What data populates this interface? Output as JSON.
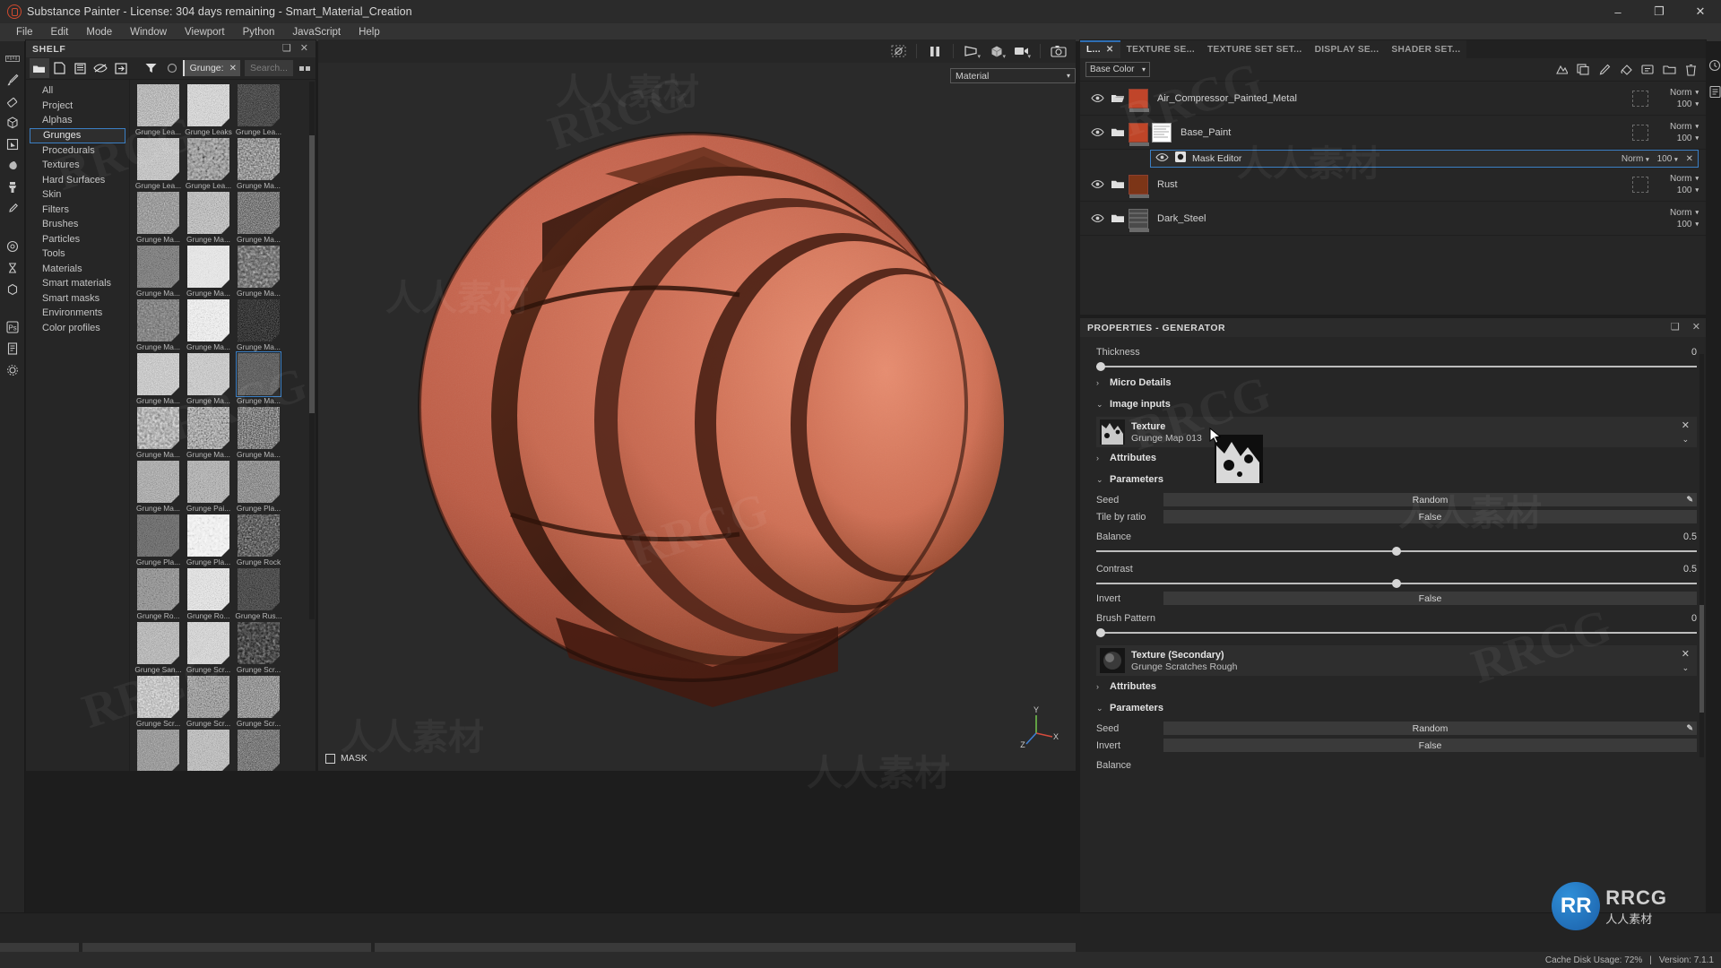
{
  "window": {
    "title": "Substance Painter - License: 304 days remaining - Smart_Material_Creation",
    "app_icon": "substance-logo-icon",
    "minimize": "–",
    "maximize": "❐",
    "close": "✕"
  },
  "menu": {
    "items": [
      "File",
      "Edit",
      "Mode",
      "Window",
      "Viewport",
      "Python",
      "JavaScript",
      "Help"
    ]
  },
  "toolstrip": {
    "tools": [
      {
        "name": "paint-tool",
        "icon": "brush-icon"
      },
      {
        "name": "eraser-tool",
        "icon": "eraser-icon"
      },
      {
        "name": "projection-tool",
        "icon": "cube-icon"
      },
      {
        "name": "polygon-fill-tool",
        "icon": "polygon-fill-icon"
      },
      {
        "name": "smudge-tool",
        "icon": "smudge-icon"
      },
      {
        "name": "clone-tool",
        "icon": "clone-stamp-icon"
      },
      {
        "name": "color-picker-tool",
        "icon": "eyedropper-icon"
      },
      {
        "name": "material-tool",
        "icon": "sphere-icon"
      },
      {
        "name": "bake-tool",
        "icon": "hourglass-icon"
      },
      {
        "name": "geometry-tool",
        "icon": "geometry-icon"
      },
      {
        "name": "photoshop-link",
        "icon": "ps-icon"
      },
      {
        "name": "export-tool",
        "icon": "page-icon"
      },
      {
        "name": "settings-tool",
        "icon": "gear-icon"
      }
    ]
  },
  "shelf": {
    "title": "SHELF",
    "header_buttons": [
      "float-panel-icon",
      "close-icon"
    ],
    "toolbar_icons": [
      "folder-icon",
      "new-file-icon",
      "save-icon",
      "hide-icon",
      "import-icon",
      "filter-icon",
      "circle-icon"
    ],
    "filter_chip": {
      "label": "Grunge:",
      "close": "✕"
    },
    "search_placeholder": "Search...",
    "categories": [
      {
        "label": "All",
        "selected": false
      },
      {
        "label": "Project",
        "selected": false
      },
      {
        "label": "Alphas",
        "selected": false
      },
      {
        "label": "Grunges",
        "selected": true
      },
      {
        "label": "Procedurals",
        "selected": false
      },
      {
        "label": "Textures",
        "selected": false
      },
      {
        "label": "Hard Surfaces",
        "selected": false
      },
      {
        "label": "Skin",
        "selected": false
      },
      {
        "label": "Filters",
        "selected": false
      },
      {
        "label": "Brushes",
        "selected": false
      },
      {
        "label": "Particles",
        "selected": false
      },
      {
        "label": "Tools",
        "selected": false
      },
      {
        "label": "Materials",
        "selected": false
      },
      {
        "label": "Smart materials",
        "selected": false
      },
      {
        "label": "Smart masks",
        "selected": false
      },
      {
        "label": "Environments",
        "selected": false
      },
      {
        "label": "Color profiles",
        "selected": false
      }
    ],
    "assets": [
      {
        "label": "Grunge Lea...",
        "tone": "t-a",
        "selected": false
      },
      {
        "label": "Grunge Leaks",
        "tone": "t-b",
        "selected": false
      },
      {
        "label": "Grunge Lea...",
        "tone": "t-c",
        "selected": false
      },
      {
        "label": "Grunge Lea...",
        "tone": "t-d",
        "selected": false
      },
      {
        "label": "Grunge Lea...",
        "tone": "t-e",
        "selected": false
      },
      {
        "label": "Grunge Ma...",
        "tone": "t-f",
        "selected": false
      },
      {
        "label": "Grunge Ma...",
        "tone": "t-g",
        "selected": false
      },
      {
        "label": "Grunge Ma...",
        "tone": "t-h",
        "selected": false
      },
      {
        "label": "Grunge Ma...",
        "tone": "t-i",
        "selected": false
      },
      {
        "label": "Grunge Ma...",
        "tone": "t-j",
        "selected": false
      },
      {
        "label": "Grunge Ma...",
        "tone": "t-k",
        "selected": false
      },
      {
        "label": "Grunge Ma...",
        "tone": "t-l",
        "selected": false
      },
      {
        "label": "Grunge Ma...",
        "tone": "t-m",
        "selected": false
      },
      {
        "label": "Grunge Ma...",
        "tone": "t-n",
        "selected": false
      },
      {
        "label": "Grunge Ma...",
        "tone": "t-o",
        "selected": false
      },
      {
        "label": "Grunge Ma...",
        "tone": "t-p",
        "selected": false
      },
      {
        "label": "Grunge Ma...",
        "tone": "t-q",
        "selected": false
      },
      {
        "label": "Grunge Ma...",
        "tone": "t-r",
        "selected": true
      },
      {
        "label": "Grunge Ma...",
        "tone": "t-s",
        "selected": false
      },
      {
        "label": "Grunge Ma...",
        "tone": "t-t",
        "selected": false
      },
      {
        "label": "Grunge Ma...",
        "tone": "t-u",
        "selected": false
      },
      {
        "label": "Grunge Ma...",
        "tone": "t-v",
        "selected": false
      },
      {
        "label": "Grunge Pai...",
        "tone": "t-w",
        "selected": false
      },
      {
        "label": "Grunge Pla...",
        "tone": "t-x",
        "selected": false
      },
      {
        "label": "Grunge Pla...",
        "tone": "t-y",
        "selected": false
      },
      {
        "label": "Grunge Pla...",
        "tone": "t-z",
        "selected": false
      },
      {
        "label": "Grunge Rock",
        "tone": "t-a2",
        "selected": false
      },
      {
        "label": "Grunge Ro...",
        "tone": "t-b2",
        "selected": false
      },
      {
        "label": "Grunge Ro...",
        "tone": "t-c2",
        "selected": false
      },
      {
        "label": "Grunge Rus...",
        "tone": "t-d2",
        "selected": false
      },
      {
        "label": "Grunge San...",
        "tone": "t-e2",
        "selected": false
      },
      {
        "label": "Grunge Scr...",
        "tone": "t-f2",
        "selected": false
      },
      {
        "label": "Grunge Scr...",
        "tone": "t-g2",
        "selected": false
      },
      {
        "label": "Grunge Scr...",
        "tone": "t-h2",
        "selected": false
      },
      {
        "label": "Grunge Scr...",
        "tone": "t-i2",
        "selected": false
      },
      {
        "label": "Grunge Scr...",
        "tone": "t-j2",
        "selected": false
      },
      {
        "label": "",
        "tone": "t-k2",
        "selected": false
      },
      {
        "label": "",
        "tone": "t-l2",
        "selected": false
      },
      {
        "label": "",
        "tone": "t-m2",
        "selected": false
      }
    ]
  },
  "viewport": {
    "toolbar_icons": [
      "no-shader-icon",
      "pause-icon",
      "camera-frustum-icon",
      "3d-view-icon",
      "video-icon",
      "screenshot-icon"
    ],
    "material_select": {
      "value": "Material",
      "chev": "⌄"
    },
    "mask_badge": "MASK",
    "axis_labels": {
      "x": "X",
      "y": "Y",
      "z": "Z"
    }
  },
  "layers": {
    "tabs": [
      {
        "label": "L...",
        "active": true,
        "closable": true
      },
      {
        "label": "TEXTURE SE...",
        "active": false,
        "closable": false
      },
      {
        "label": "TEXTURE SET SET...",
        "active": false,
        "closable": false
      },
      {
        "label": "DISPLAY SE...",
        "active": false,
        "closable": false
      },
      {
        "label": "SHADER SET...",
        "active": false,
        "closable": false
      }
    ],
    "channel": {
      "value": "Base Color",
      "chev": "⌄"
    },
    "toolbar_icons": [
      "add-effect-icon",
      "copy-icon",
      "paint-layer-icon",
      "fill-layer-icon",
      "group-icon",
      "folder-icon",
      "delete-icon"
    ],
    "side_icons": [
      "history-icon",
      "list-icon"
    ],
    "rows": [
      {
        "name": "Air_Compressor_Painted_Metal",
        "type": "group-open",
        "blend": "Norm",
        "opacity": "100",
        "visible": true,
        "color": "#c0452a",
        "has_mask_slot": true,
        "has_mask_thumb": false
      },
      {
        "name": "Base_Paint",
        "type": "group-closed",
        "blend": "Norm",
        "opacity": "100",
        "visible": true,
        "color": "#bf4528",
        "has_mask_slot": true,
        "has_mask_thumb": true,
        "sublayer": {
          "name": "Mask Editor",
          "blend": "Norm",
          "opacity": "100",
          "visible": true,
          "selected": true,
          "close": "✕"
        }
      },
      {
        "name": "Rust",
        "type": "group-closed",
        "blend": "Norm",
        "opacity": "100",
        "visible": true,
        "color": "#7c3517",
        "has_mask_slot": true,
        "has_mask_thumb": false
      },
      {
        "name": "Dark_Steel",
        "type": "group-closed",
        "blend": "Norm",
        "opacity": "100",
        "visible": true,
        "color": "#4a4a4a",
        "has_mask_slot": false,
        "has_mask_thumb": false
      }
    ]
  },
  "properties": {
    "title": "PROPERTIES - GENERATOR",
    "header_buttons": [
      "float-panel-icon",
      "close-icon"
    ],
    "thickness": {
      "label": "Thickness",
      "value": "0",
      "knob_pct": 0
    },
    "micro_details": {
      "label": "Micro Details",
      "caret": "›",
      "expanded": false
    },
    "image_inputs": {
      "label": "Image inputs",
      "caret": "⌄",
      "expanded": true,
      "texture": {
        "title": "Texture",
        "subtitle": "Grunge Map 013",
        "close": "✕",
        "chev": "⌄"
      }
    },
    "attributes_1": {
      "label": "Attributes",
      "caret": "›",
      "expanded": false
    },
    "parameters_1": {
      "label": "Parameters",
      "caret": "⌄",
      "fields": [
        {
          "label": "Seed",
          "value": "Random",
          "kind": "text",
          "editable": true
        },
        {
          "label": "Tile by ratio",
          "value": "False",
          "kind": "text",
          "editable": false
        },
        {
          "label": "Balance",
          "value": "0.5",
          "kind": "slider",
          "knob_pct": 50
        },
        {
          "label": "Contrast",
          "value": "0.5",
          "kind": "slider",
          "knob_pct": 50
        },
        {
          "label": "Invert",
          "value": "False",
          "kind": "text",
          "editable": false
        },
        {
          "label": "Brush Pattern",
          "value": "0",
          "kind": "slider",
          "knob_pct": 0
        }
      ]
    },
    "texture_secondary": {
      "title": "Texture (Secondary)",
      "subtitle": "Grunge Scratches Rough",
      "close": "✕",
      "chev": "⌄"
    },
    "attributes_2": {
      "label": "Attributes",
      "caret": "›",
      "expanded": false
    },
    "parameters_2": {
      "label": "Parameters",
      "caret": "⌄",
      "fields": [
        {
          "label": "Seed",
          "value": "Random",
          "kind": "text",
          "editable": true
        },
        {
          "label": "Invert",
          "value": "False",
          "kind": "text",
          "editable": false
        },
        {
          "label": "Balance",
          "value": "",
          "kind": "slider",
          "knob_pct": 48
        }
      ]
    }
  },
  "status": {
    "cache_disk_usage": "Cache Disk Usage: 72%",
    "version": "Version: 7.1.1",
    "separator": "|"
  },
  "watermarks": {
    "rrcg": "RRCG",
    "chinese": "人人素材",
    "logo_letters": "RR",
    "logo_name": "RRCG",
    "logo_sub": "人人素材"
  },
  "colors": {
    "accent_blue": "#3b7fc4",
    "panel_bg": "#262626",
    "viewport_bg": "#2a2a2a",
    "model_orange": "#c96a52",
    "mask_orange": "#dd8a2a"
  }
}
